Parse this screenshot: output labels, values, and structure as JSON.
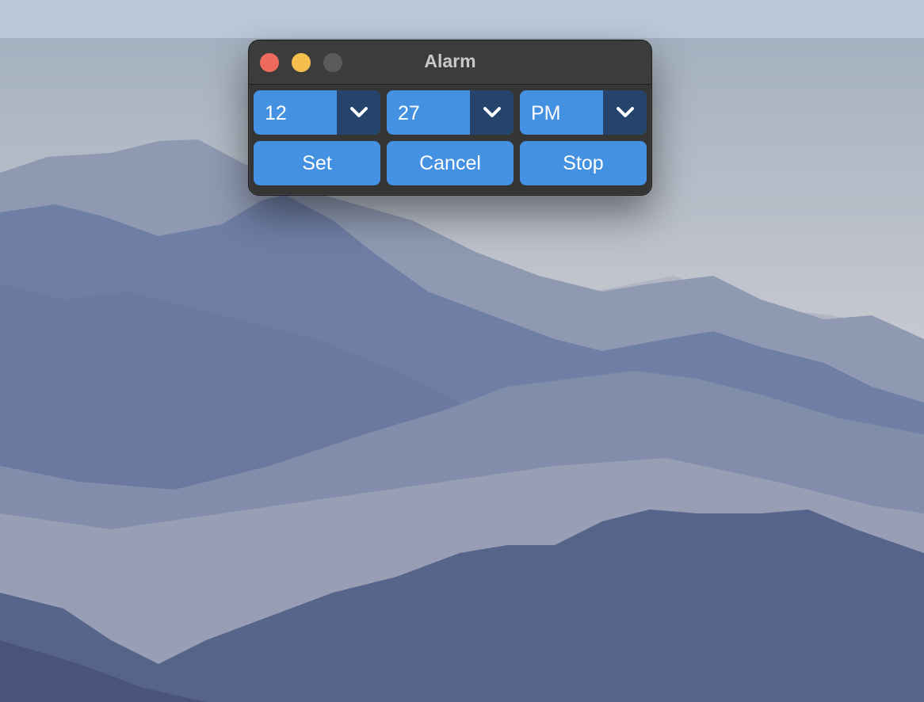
{
  "window": {
    "title": "Alarm"
  },
  "selects": {
    "hour": "12",
    "minute": "27",
    "period": "PM"
  },
  "buttons": {
    "set": "Set",
    "cancel": "Cancel",
    "stop": "Stop"
  },
  "icons": {
    "close": "close-icon",
    "minimize": "minimize-icon",
    "maximize": "maximize-icon",
    "dropdown": "chevron-down-icon"
  },
  "colors": {
    "accent": "#4391e0",
    "dropdown_arrow_bg": "#24446c",
    "window_bg": "#353535",
    "close": "#ec6a5e",
    "minimize": "#f4bf4f",
    "maximize_disabled": "#5a5a5a"
  }
}
